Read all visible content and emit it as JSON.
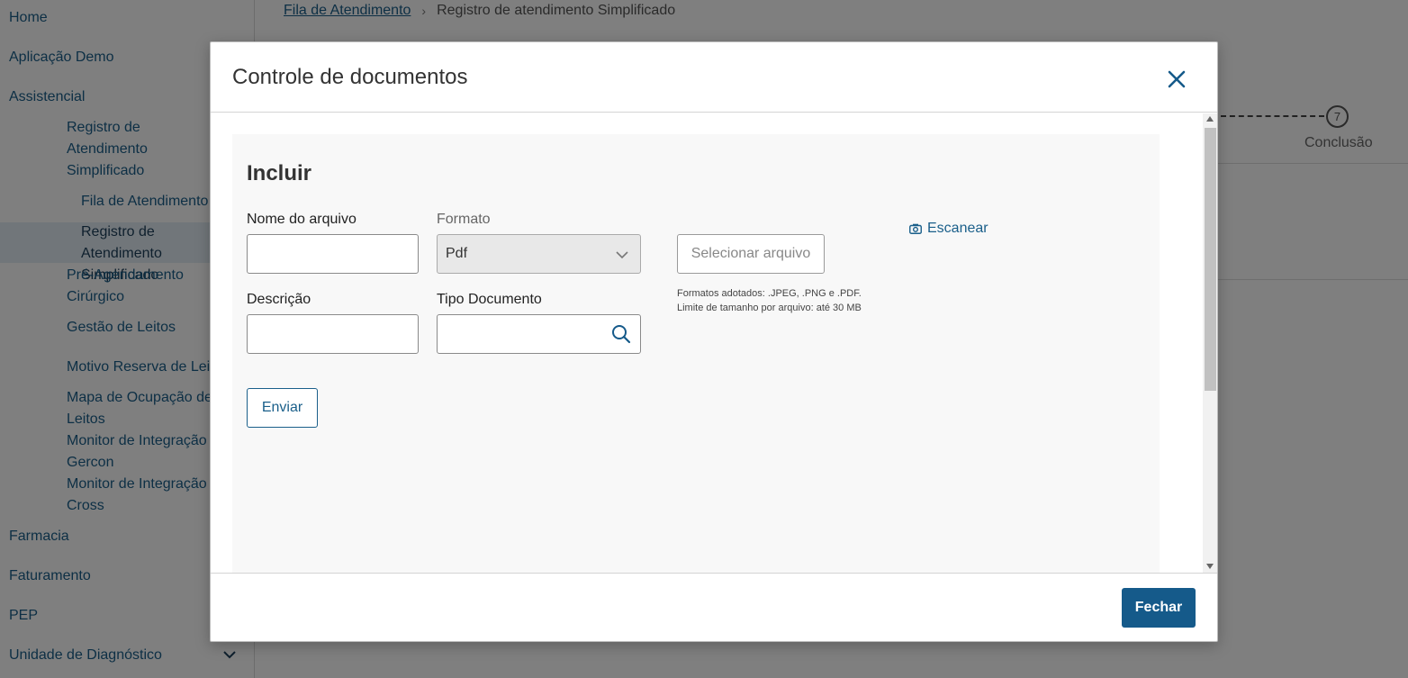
{
  "sidebar": {
    "items": [
      {
        "label": "Home"
      },
      {
        "label": "Aplicação Demo"
      },
      {
        "label": "Assistencial"
      },
      {
        "label": "Registro de Atendimento Simplificado"
      },
      {
        "label": "Fila de Atendimento"
      },
      {
        "label": "Registro de Atendimento Simplificado"
      },
      {
        "label": "Pré-Agendamento Cirúrgico"
      },
      {
        "label": "Gestão de Leitos"
      },
      {
        "label": "Motivo Reserva de Leitos"
      },
      {
        "label": "Mapa de Ocupação de Leitos"
      },
      {
        "label": "Monitor de Integração Gercon"
      },
      {
        "label": "Monitor de Integração Cross"
      },
      {
        "label": "Farmacia"
      },
      {
        "label": "Faturamento"
      },
      {
        "label": "PEP"
      },
      {
        "label": "Unidade de Diagnóstico"
      }
    ]
  },
  "breadcrumb": {
    "link": "Fila de Atendimento",
    "separator": "›",
    "current": "Registro de atendimento Simplificado"
  },
  "stepper": {
    "step_number": "7",
    "step_label": "Conclusão"
  },
  "modal": {
    "title": "Controle de documentos",
    "panel_title": "Incluir",
    "fields": {
      "file_name_label": "Nome do arquivo",
      "file_name_value": "",
      "format_label": "Formato",
      "format_value": "Pdf",
      "description_label": "Descrição",
      "description_value": "",
      "doc_type_label": "Tipo Documento",
      "doc_type_value": ""
    },
    "select_file_button": "Selecionar arquivo",
    "hint_formats": "Formatos adotados: .JPEG, .PNG e .PDF.",
    "hint_size": "Limite de tamanho por arquivo: até 30 MB",
    "scan_link": "Escanear",
    "send_button": "Enviar",
    "close_button": "Fechar"
  },
  "colors": {
    "accent": "#1a5f8a",
    "primary_button": "#155a8a"
  }
}
